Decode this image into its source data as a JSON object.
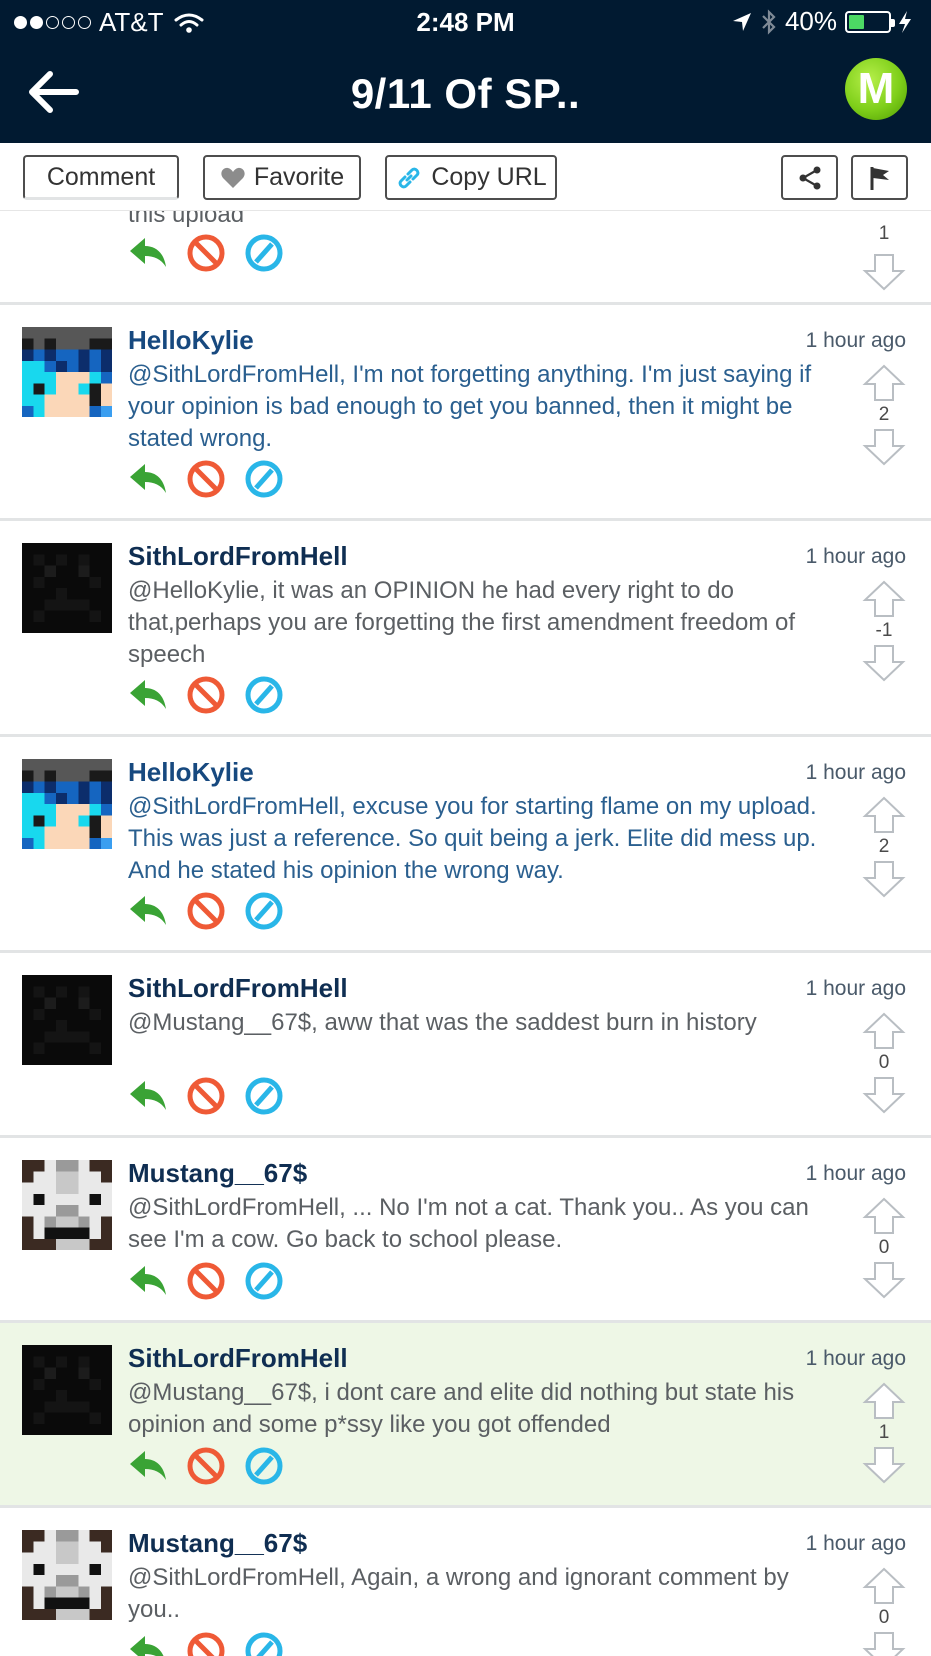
{
  "status_bar": {
    "carrier": "AT&T",
    "signal_bars_filled": 2,
    "time": "2:48 PM",
    "battery": "40%",
    "battery_level": 0.4
  },
  "nav": {
    "title": "9/11 Of SP..",
    "logo_letter": "M"
  },
  "toolbar": {
    "comment": "Comment",
    "favorite": "Favorite",
    "copy_url": "Copy URL"
  },
  "comments": [
    {
      "user": "",
      "time": "",
      "text": "this upload",
      "score": "1",
      "avatar": "black-skin",
      "blue": false,
      "highlight": false
    },
    {
      "user": "HelloKylie",
      "time": "1 hour ago",
      "text": "@SithLordFromHell, I'm not forgetting anything. I'm just saying if your opinion is bad enough to get you banned, then it might be stated wrong.",
      "score": "2",
      "avatar": "blue-hair-skin",
      "blue": true,
      "highlight": false
    },
    {
      "user": "SithLordFromHell",
      "time": "1 hour ago",
      "text": "@HelloKylie, it was an OPINION he had every right to do that,perhaps you are forgetting the first amendment freedom of speech",
      "score": "-1",
      "avatar": "black-skin",
      "blue": false,
      "highlight": false
    },
    {
      "user": "HelloKylie",
      "time": "1 hour ago",
      "text": "@SithLordFromHell, excuse you for starting flame on my upload. This was just a reference. So quit being a jerk. Elite did mess up. And he stated his opinion the wrong way.",
      "score": "2",
      "avatar": "blue-hair-skin",
      "blue": true,
      "highlight": false
    },
    {
      "user": "SithLordFromHell",
      "time": "1 hour ago",
      "text": "@Mustang__67$, aww that was the saddest burn in history",
      "score": "0",
      "avatar": "black-skin",
      "blue": false,
      "highlight": false
    },
    {
      "user": "Mustang__67$",
      "time": "1 hour ago",
      "text": "@SithLordFromHell, ... No I'm not a cat. Thank you.. As you can see I'm a cow. Go back to school please.",
      "score": "0",
      "avatar": "cow-skin",
      "blue": false,
      "highlight": false
    },
    {
      "user": "SithLordFromHell",
      "time": "1 hour ago",
      "text": "@Mustang__67$, i dont care and elite did nothing but state his opinion and some p*ssy like you got offended",
      "score": "1",
      "avatar": "black-skin",
      "blue": false,
      "highlight": true
    },
    {
      "user": "Mustang__67$",
      "time": "1 hour ago",
      "text": "@SithLordFromHell, Again, a wrong and ignorant comment by you..",
      "score": "0",
      "avatar": "cow-skin",
      "blue": false,
      "highlight": false
    }
  ],
  "colors": {
    "nav_background": "#011a31",
    "reply_green": "#3aa335",
    "block_red": "#ef5a36",
    "mod_blue": "#29b6e8",
    "highlight_row": "#eef7e6"
  }
}
